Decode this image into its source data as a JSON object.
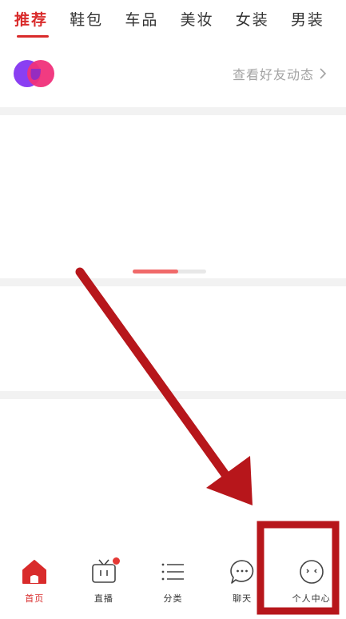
{
  "tabs": [
    {
      "label": "推荐",
      "active": true
    },
    {
      "label": "鞋包",
      "active": false
    },
    {
      "label": "车品",
      "active": false
    },
    {
      "label": "美妆",
      "active": false
    },
    {
      "label": "女装",
      "active": false
    },
    {
      "label": "男装",
      "active": false
    }
  ],
  "friends": {
    "link_label": "查看好友动态",
    "logo_icon": "dual-circle-logo-icon",
    "chevron_icon": "chevron-right-icon"
  },
  "banner": {
    "carousel_progress": 0.62
  },
  "bottom_nav": [
    {
      "label": "首页",
      "icon": "home-icon",
      "active": true,
      "badge": false
    },
    {
      "label": "直播",
      "icon": "tv-icon",
      "active": false,
      "badge": true
    },
    {
      "label": "分类",
      "icon": "list-icon",
      "active": false,
      "badge": false
    },
    {
      "label": "聊天",
      "icon": "chat-icon",
      "active": false,
      "badge": false
    },
    {
      "label": "个人中心",
      "icon": "profile-face-icon",
      "active": false,
      "badge": false
    }
  ],
  "colors": {
    "accent": "#d92b2b",
    "annotation": "#b7161b",
    "separator": "#f2f2f2",
    "muted_text": "#a3a3a3",
    "logo_purple": "#8a3ff2",
    "logo_pink": "#f0307a"
  }
}
